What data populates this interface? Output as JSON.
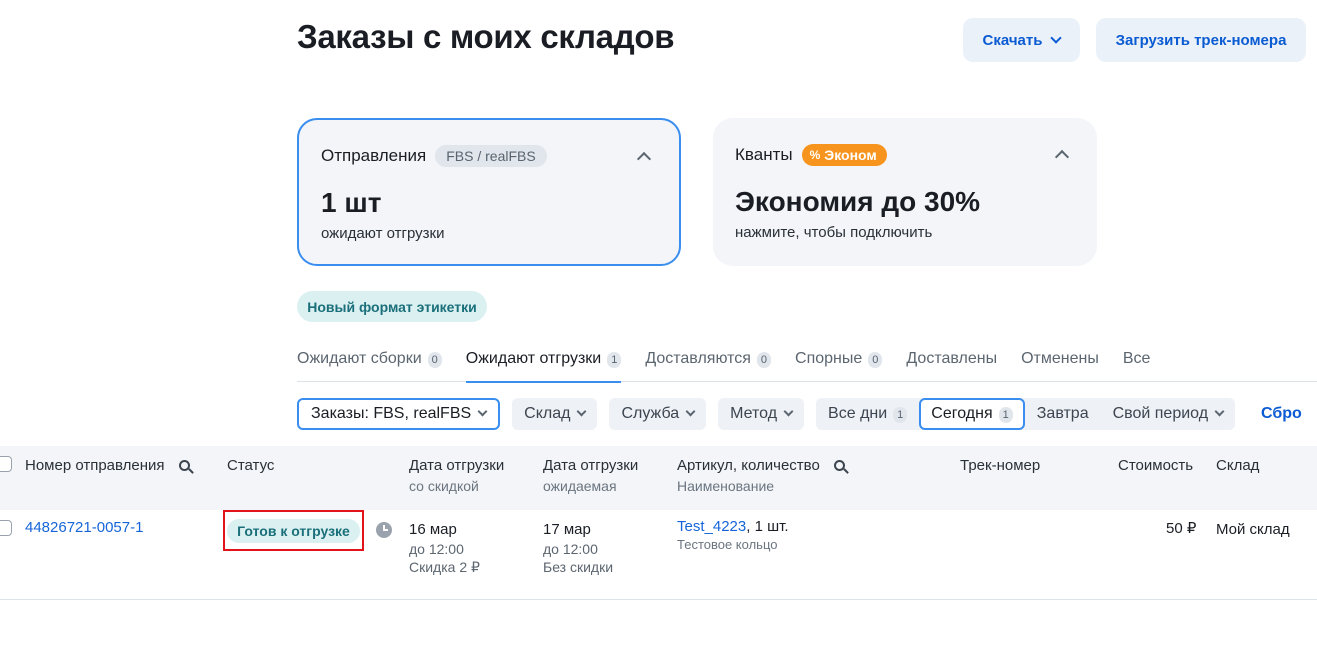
{
  "header": {
    "title": "Заказы с моих складов",
    "download_label": "Скачать",
    "upload_label": "Загрузить трек-номера"
  },
  "cards": {
    "shipments": {
      "title": "Отправления",
      "badge": "FBS / realFBS",
      "big": "1 шт",
      "sub": "ожидают отгрузки"
    },
    "kvanty": {
      "title": "Кванты",
      "badge_icon": "%",
      "badge": "Эконом",
      "big": "Экономия до 30%",
      "sub": "нажмите, чтобы подключить"
    }
  },
  "label_chip": "Новый формат этикетки",
  "tabs": [
    {
      "label": "Ожидают сборки",
      "count": "0"
    },
    {
      "label": "Ожидают отгрузки",
      "count": "1"
    },
    {
      "label": "Доставляются",
      "count": "0"
    },
    {
      "label": "Спорные",
      "count": "0"
    },
    {
      "label": "Доставлены",
      "count": ""
    },
    {
      "label": "Отменены",
      "count": ""
    },
    {
      "label": "Все",
      "count": ""
    }
  ],
  "active_tab": "Ожидают отгрузки",
  "filters": {
    "orders": "Заказы: FBS, realFBS",
    "warehouse": "Склад",
    "service": "Служба",
    "method": "Метод",
    "all_days": "Все дни",
    "all_days_count": "1",
    "today": "Сегодня",
    "today_count": "1",
    "tomorrow": "Завтра",
    "own_period": "Свой период",
    "reset": "Сбро"
  },
  "table": {
    "headers": {
      "number": "Номер отправления",
      "status": "Статус",
      "ship_date": "Дата отгрузки",
      "ship_date_sub": "со скидкой",
      "ship_date2": "Дата отгрузки",
      "ship_date2_sub": "ожидаемая",
      "article": "Артикул, количество",
      "article_sub": "Наименование",
      "track": "Трек-номер",
      "cost": "Стоимость",
      "warehouse": "Склад"
    },
    "rows": [
      {
        "number": "44826721-0057-1",
        "status": "Готов к отгрузке",
        "ship_date": "16 мар",
        "ship_time": "до 12:00",
        "discount": "Скидка 2 ₽",
        "exp_date": "17 мар",
        "exp_time": "до 12:00",
        "no_discount": "Без скидки",
        "article": "Test_4223",
        "qty": ", 1 шт.",
        "name": "Тестовое кольцо",
        "cost": "50 ₽",
        "warehouse": "Мой склад"
      }
    ]
  },
  "colors": {
    "accent": "#3a8ef0",
    "link": "#1565d8",
    "badge_orange": "#f7941d",
    "status_bg": "#dbf0f1",
    "highlight_red": "#e0141a"
  }
}
